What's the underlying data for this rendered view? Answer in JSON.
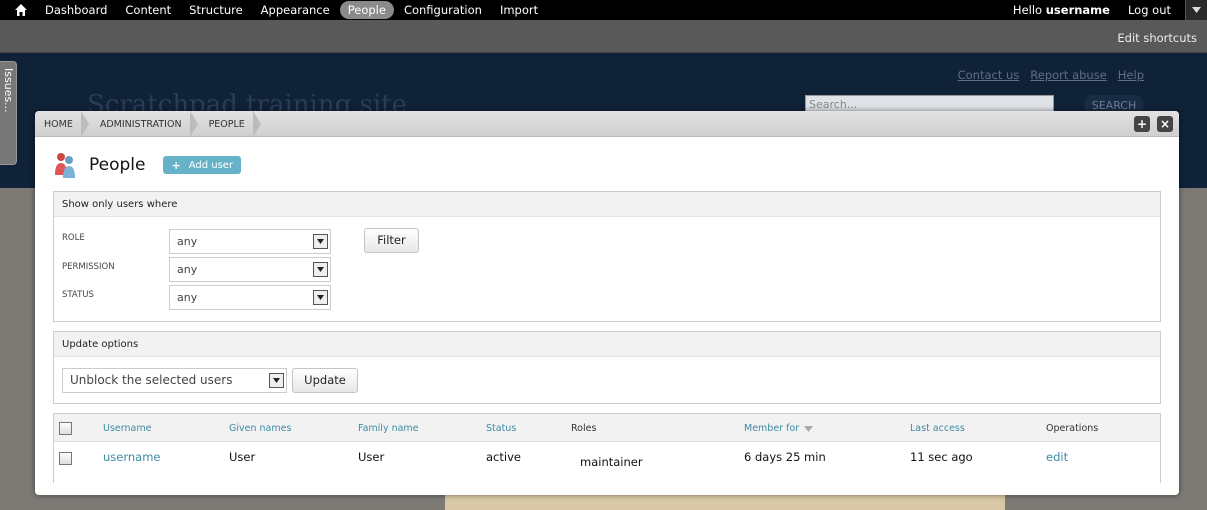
{
  "toolbar": {
    "menu": [
      "Dashboard",
      "Content",
      "Structure",
      "Appearance",
      "People",
      "Configuration",
      "Import"
    ],
    "active_item": "People",
    "hello_prefix": "Hello",
    "username": "username",
    "logout": "Log out"
  },
  "shortcuts": {
    "edit_label": "Edit shortcuts"
  },
  "site": {
    "name": "Scratchpad training site",
    "links": [
      "Contact us",
      "Report abuse",
      "Help"
    ],
    "search_placeholder": "Search...",
    "search_button": "SEARCH",
    "issues_tab": "Issues..."
  },
  "overlay": {
    "breadcrumbs": [
      "Home",
      "Administration",
      "People"
    ],
    "title": "People",
    "add_user_label": "Add user",
    "filter": {
      "legend": "Show only users where",
      "role_label": "ROLE",
      "role_value": "any",
      "permission_label": "PERMISSION",
      "permission_value": "any",
      "status_label": "STATUS",
      "status_value": "any",
      "button": "Filter"
    },
    "update": {
      "legend": "Update options",
      "selected_action": "Unblock the selected users",
      "button": "Update"
    },
    "table": {
      "columns": [
        "Username",
        "Given names",
        "Family name",
        "Status",
        "Roles",
        "Member for",
        "Last access",
        "Operations"
      ],
      "rows": [
        {
          "username": "username",
          "given_names": "User",
          "family_name": "User",
          "status": "active",
          "roles": "maintainer",
          "member_for": "6 days 25 min",
          "last_access": "11 sec ago",
          "operation": "edit"
        }
      ]
    }
  },
  "colors": {
    "accent": "#3d8ba3",
    "add_button": "#66b3c9",
    "toolbar": "#000000"
  }
}
